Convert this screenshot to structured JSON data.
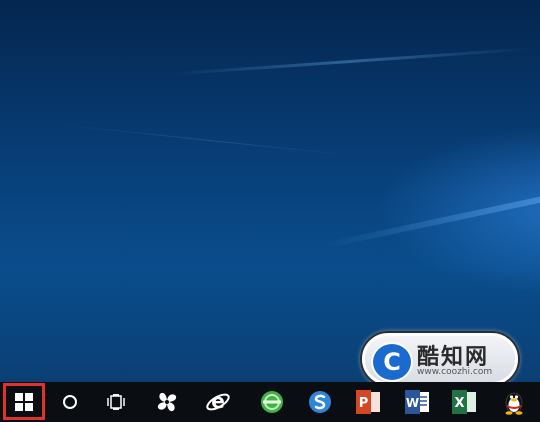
{
  "watermark": {
    "logo_glyph": "C",
    "title": "酷知网",
    "url": "www.coozhi.com"
  },
  "taskbar": {
    "highlight_color": "#e0322d",
    "items": [
      {
        "name": "start-button",
        "icon": "windows-logo-icon"
      },
      {
        "name": "search-button",
        "icon": "cortana-circle-icon"
      },
      {
        "name": "task-view-button",
        "icon": "task-view-icon"
      },
      {
        "name": "pinned-app-1",
        "icon": "pinwheel-app-icon"
      },
      {
        "name": "internet-explorer",
        "icon": "internet-explorer-icon"
      },
      {
        "name": "pinned-browser-green",
        "icon": "green-browser-icon"
      },
      {
        "name": "pinned-browser-blue",
        "icon": "sogou-browser-icon"
      },
      {
        "name": "powerpoint",
        "icon": "powerpoint-icon"
      },
      {
        "name": "word",
        "icon": "word-icon"
      },
      {
        "name": "excel",
        "icon": "excel-icon"
      },
      {
        "name": "qq",
        "icon": "qq-penguin-icon"
      }
    ]
  }
}
